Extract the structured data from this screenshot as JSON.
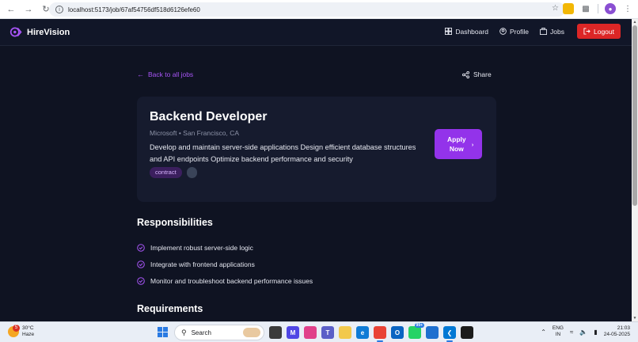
{
  "browser": {
    "url": "localhost:5173/job/67af54756df518d6126efe60"
  },
  "app": {
    "brand": "HireVision",
    "nav": {
      "dashboard": "Dashboard",
      "profile": "Profile",
      "jobs": "Jobs",
      "logout": "Logout"
    }
  },
  "page": {
    "back_link": "Back to all jobs",
    "share": "Share",
    "job": {
      "title": "Backend Developer",
      "meta": "Microsoft • San Francisco, CA",
      "description": "Develop and maintain server-side applications Design efficient database structures and API endpoints Optimize backend performance and security",
      "tags": [
        "contract",
        ""
      ],
      "apply_label": "Apply Now"
    },
    "responsibilities": {
      "title": "Responsibilities",
      "items": [
        "Implement robust server-side logic",
        "Integrate with frontend applications",
        "Monitor and troubleshoot backend performance issues"
      ]
    },
    "requirements": {
      "title": "Requirements"
    }
  },
  "taskbar": {
    "weather_temp": "30°C",
    "weather_desc": "Haze",
    "weather_badge": "5",
    "search": "Search",
    "badge_99": "99+",
    "lang_1": "ENG",
    "lang_2": "IN",
    "time": "21:03",
    "date": "24-05-2025"
  },
  "colors": {
    "accent": "#9333ea",
    "logout": "#dc2626",
    "background": "#0f1322",
    "card": "#161b2e"
  }
}
